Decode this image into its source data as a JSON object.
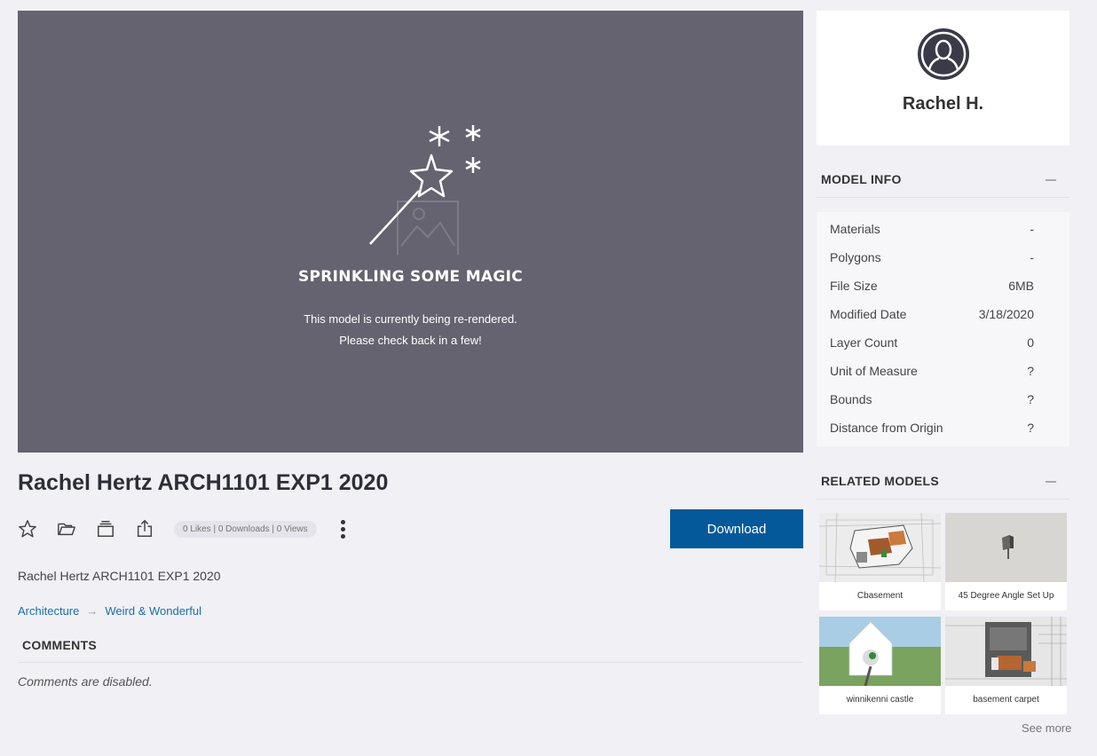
{
  "viewer": {
    "title": "SPRINKLING SOME MAGIC",
    "message_line1": "This model is currently being re-rendered.",
    "message_line2": "Please check back in a few!"
  },
  "model": {
    "title": "Rachel Hertz ARCH1101 EXP1 2020",
    "description": "Rachel Hertz ARCH1101 EXP1 2020",
    "stats": "0 Likes | 0 Downloads | 0 Views",
    "download_label": "Download"
  },
  "breadcrumb": [
    "Architecture",
    "Weird & Wonderful"
  ],
  "comments": {
    "heading": "COMMENTS",
    "status": "Comments are disabled."
  },
  "author": {
    "name": "Rachel H."
  },
  "model_info": {
    "heading": "MODEL INFO",
    "rows": [
      {
        "label": "Materials",
        "value": "-"
      },
      {
        "label": "Polygons",
        "value": "-"
      },
      {
        "label": "File Size",
        "value": "6MB"
      },
      {
        "label": "Modified Date",
        "value": "3/18/2020"
      },
      {
        "label": "Layer Count",
        "value": "0"
      },
      {
        "label": "Unit of Measure",
        "value": "?"
      },
      {
        "label": "Bounds",
        "value": "?"
      },
      {
        "label": "Distance from Origin",
        "value": "?"
      }
    ]
  },
  "related": {
    "heading": "RELATED MODELS",
    "items": [
      {
        "caption": "Cbasement"
      },
      {
        "caption": "45 Degree Angle Set Up"
      },
      {
        "caption": "winnikenni castle"
      },
      {
        "caption": "basement carpet"
      }
    ],
    "see_more": "See more"
  },
  "icons": [
    "star-icon",
    "folder-icon",
    "collection-icon",
    "share-icon",
    "more-icon",
    "magic-wand-icon",
    "minus-icon"
  ],
  "colors": {
    "accent": "#03599a",
    "viewer_bg": "#65636f",
    "link": "#1d6fa5"
  }
}
